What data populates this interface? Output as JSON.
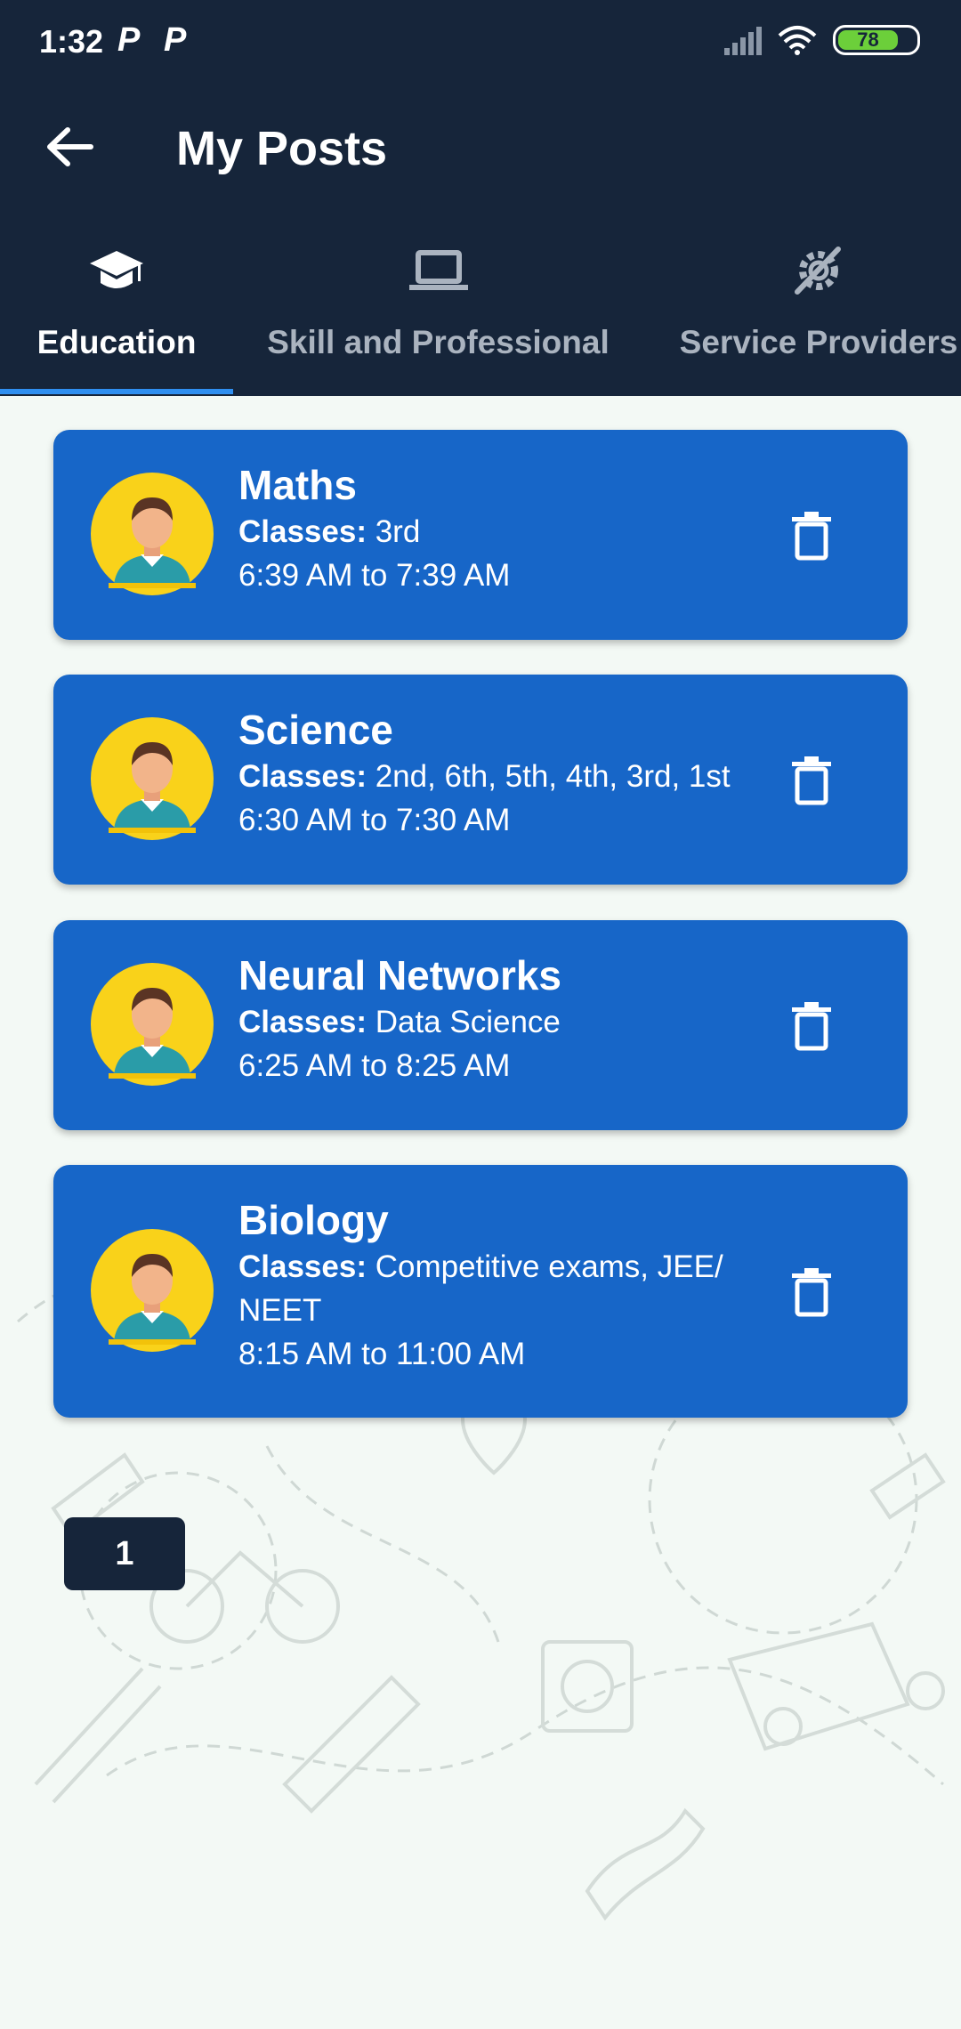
{
  "status_bar": {
    "time": "1:32",
    "notif_icons": [
      "P",
      "P"
    ],
    "battery": "78",
    "battery_level": 0.78,
    "icons": [
      "signal-icon",
      "wifi-icon",
      "battery-icon"
    ]
  },
  "toolbar": {
    "title": "My Posts",
    "back_icon": "back-arrow-icon"
  },
  "tabs": [
    {
      "label": "Education",
      "icon": "graduation-cap-icon",
      "active": true
    },
    {
      "label": "Skill and Professional",
      "icon": "laptop-icon",
      "active": false
    },
    {
      "label": "Service Providers",
      "icon": "tools-gear-icon",
      "active": false
    }
  ],
  "posts": [
    {
      "subject": "Maths",
      "classes_label": "Classes:",
      "classes": " 3rd",
      "time": "6:39 AM to 7:39 AM"
    },
    {
      "subject": "Science",
      "classes_label": "Classes:",
      "classes": " 2nd, 6th, 5th, 4th, 3rd, 1st",
      "time": "6:30 AM to 7:30 AM"
    },
    {
      "subject": "Neural Networks",
      "classes_label": "Classes:",
      "classes": " Data Science",
      "time": "6:25 AM to 8:25 AM"
    },
    {
      "subject": "Biology",
      "classes_label": "Classes:",
      "classes": " Competitive exams, JEE/ NEET",
      "time": "8:15 AM to 11:00 AM"
    }
  ],
  "pagination": {
    "current_page": "1"
  },
  "colors": {
    "appbar": "#16253a",
    "card": "#1766c8",
    "tab_indicator": "#2f8ff0",
    "avatar_bg": "#f9d21a",
    "background": "#f3f9f5"
  }
}
